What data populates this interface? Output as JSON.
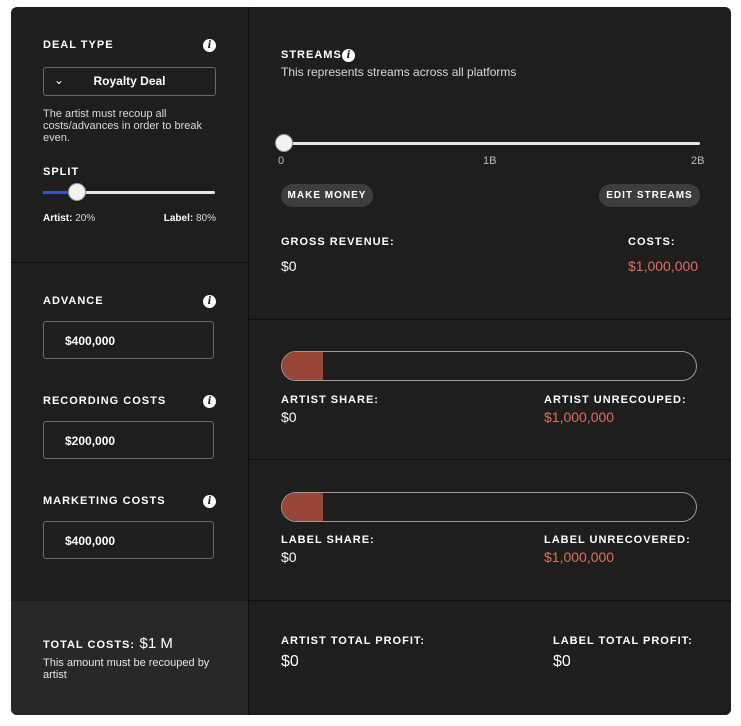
{
  "deal": {
    "label": "DEAL TYPE",
    "selected": "Royalty Deal",
    "note": "The artist must recoup all costs/advances in order to break even."
  },
  "split": {
    "label": "SPLIT",
    "artist_prefix": "Artist:",
    "artist_value": "20%",
    "label_prefix": "Label:",
    "label_value": "80%",
    "artist_fraction": 0.2
  },
  "costs": {
    "advance_label": "ADVANCE",
    "advance_value": "$400,000",
    "recording_label": "RECORDING COSTS",
    "recording_value": "$200,000",
    "marketing_label": "MARKETING COSTS",
    "marketing_value": "$400,000"
  },
  "total": {
    "label": "TOTAL COSTS:",
    "value": "$1 M",
    "note": "This amount must be recouped by artist"
  },
  "streams": {
    "label": "STREAMS",
    "subtitle": "This represents streams across all platforms",
    "tick_min": "0",
    "tick_mid": "1B",
    "tick_max": "2B",
    "position_fraction": 0,
    "make_money": "MAKE MONEY",
    "edit_streams": "EDIT STREAMS"
  },
  "revenue": {
    "gross_label": "GROSS REVENUE:",
    "gross_value": "$0",
    "costs_label": "COSTS:",
    "costs_value": "$1,000,000"
  },
  "artist": {
    "share_label": "ARTIST SHARE:",
    "share_value": "$0",
    "unrecouped_label": "ARTIST UNRECOUPED:",
    "unrecouped_value": "$1,000,000",
    "bar_fraction": 0.1
  },
  "label": {
    "share_label": "LABEL SHARE:",
    "share_value": "$0",
    "unrecovered_label": "LABEL UNRECOVERED:",
    "unrecovered_value": "$1,000,000",
    "bar_fraction": 0.1
  },
  "profit": {
    "artist_label": "ARTIST TOTAL PROFIT:",
    "artist_value": "$0",
    "label_label": "LABEL TOTAL PROFIT:",
    "label_value": "$0"
  },
  "colors": {
    "background": "#1e1e1e",
    "accent_blue": "#3a4fd6",
    "negative_red": "#e0705b",
    "bar_fill": "#9a4637"
  }
}
